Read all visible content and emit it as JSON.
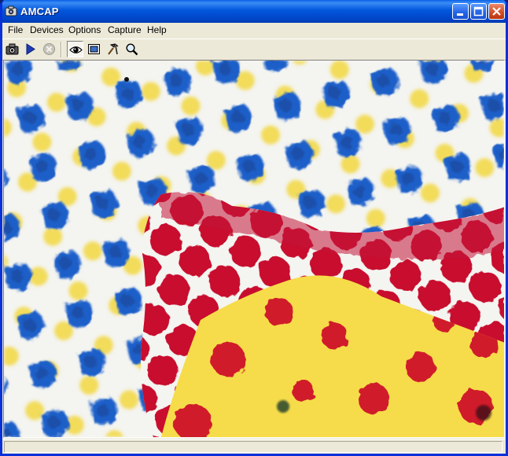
{
  "window": {
    "title": "AMCAP",
    "app_icon": "camera-icon",
    "controls": [
      "minimize-icon",
      "maximize-icon",
      "close-icon"
    ]
  },
  "menubar": {
    "items": [
      "File",
      "Devices",
      "Options",
      "Capture",
      "Help"
    ]
  },
  "toolbar": {
    "buttons": [
      {
        "icon": "camera-snapshot-icon",
        "state": "normal"
      },
      {
        "icon": "play-icon",
        "state": "normal"
      },
      {
        "icon": "stop-icon",
        "state": "disabled"
      },
      {
        "icon": "preview-eye-icon",
        "state": "pressed"
      },
      {
        "icon": "overlay-icon",
        "state": "normal"
      },
      {
        "icon": "tools-icon",
        "state": "normal"
      },
      {
        "icon": "zoom-icon",
        "state": "normal"
      }
    ]
  },
  "preview": {
    "content": "magnified halftone print dots",
    "colors": {
      "paper": "#f4f4f0",
      "blue_dot": "#1a64c8",
      "yellow": "#f5dc46",
      "magenta_red": "#d01a3c",
      "green_dot": "#1e6a50"
    }
  },
  "statusbar": {
    "text": ""
  }
}
